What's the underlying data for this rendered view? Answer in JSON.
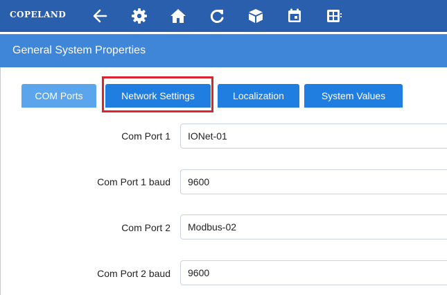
{
  "toolbar": {
    "logo": "COPELAND",
    "icons": [
      "back-arrow-icon",
      "gear-icon",
      "home-icon",
      "refresh-icon",
      "package-icon",
      "calendar-icon",
      "dashboard-icon"
    ]
  },
  "header": {
    "title": "General System Properties"
  },
  "tabs": [
    {
      "label": "COM Ports",
      "active": true
    },
    {
      "label": "Network Settings",
      "active": false
    },
    {
      "label": "Localization",
      "active": false
    },
    {
      "label": "System Values",
      "active": false
    }
  ],
  "fields": [
    {
      "label": "Com Port 1",
      "value": "IONet-01"
    },
    {
      "label": "Com Port 1 baud",
      "value": "9600"
    },
    {
      "label": "Com Port 2",
      "value": "Modbus-02"
    },
    {
      "label": "Com Port 2 baud",
      "value": "9600"
    }
  ],
  "colors": {
    "toolbar_bg": "#2a5fad",
    "titlebar_bg": "#3f85d8",
    "tab_bg": "#1f7ee0",
    "tab_active_bg": "#5aa5ec",
    "highlight": "#e0212f"
  }
}
